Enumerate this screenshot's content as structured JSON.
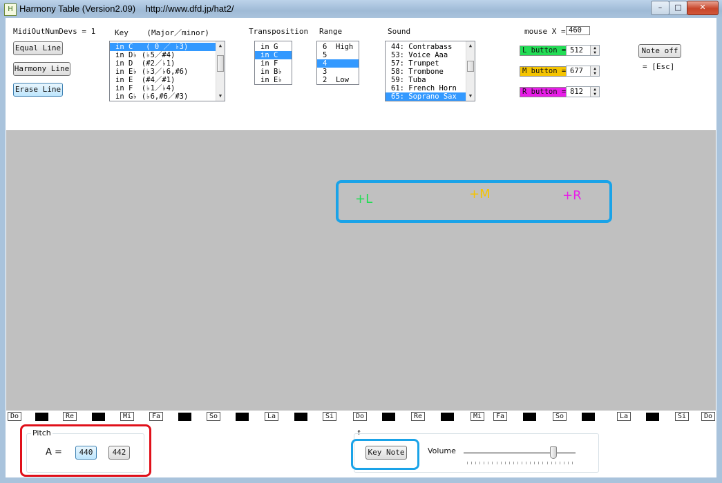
{
  "window": {
    "title": "Harmony Table (Version2.09)    http://www.dfd.jp/hat2/",
    "icon_text": "H",
    "minimize": "–",
    "maximize": "□",
    "close": "✕"
  },
  "midi": {
    "label": "MidiOutNumDevs = 1"
  },
  "line_buttons": {
    "equal": "Equal Line",
    "harmony": "Harmony Line",
    "erase": "Erase Line"
  },
  "key": {
    "header": "Key    (Major／minor)",
    "items": [
      "in C   ( 0 ／ ♭3)",
      "in D♭ (♭5／#4)",
      "in D  (#2／♭1)",
      "in E♭ (♭3／♭6,#6)",
      "in E  (#4／#1)",
      "in F  (♭1／♭4)",
      "in G♭ (♭6,#6／#3)"
    ],
    "selected_index": 0
  },
  "transposition": {
    "header": "Transposition",
    "items": [
      "in G",
      "in C",
      "in F",
      "in B♭",
      "in E♭"
    ],
    "selected_index": 1
  },
  "range": {
    "header": "Range",
    "items": [
      "6  High",
      "5",
      "4",
      "3",
      "2  Low"
    ],
    "selected_index": 2
  },
  "sound": {
    "header": "Sound",
    "items": [
      "44: Contrabass",
      "53: Voice Aaa",
      "57: Trumpet",
      "58: Trombone",
      "59: Tuba",
      "61: French Horn",
      "65: Soprano Sax"
    ],
    "selected_index": 6
  },
  "mouse": {
    "label": "mouse X =",
    "value": "460"
  },
  "mouse_buttons": {
    "l_label": "L button =",
    "l_value": "512",
    "l_color": "#22dd55",
    "m_label": "M button =",
    "m_value": "677",
    "m_color": "#f5c400",
    "r_label": "R button =",
    "r_value": "812",
    "r_color": "#e81ee8"
  },
  "note_off": {
    "label": "Note off",
    "shortcut": "= [Esc]"
  },
  "canvas": {
    "bg_color": "#c0c0c0",
    "marker_l": "+L",
    "marker_m": "+M",
    "marker_r": "+R",
    "highlight_color": "#1aa3e8"
  },
  "keyboard": {
    "white_labels": [
      "Do",
      "Re",
      "Mi",
      "Fa",
      "So",
      "La",
      "Si",
      "Do",
      "Re",
      "Mi",
      "Fa",
      "So",
      "La",
      "Si",
      "Do"
    ],
    "cursor_arrow": "↑"
  },
  "pitch": {
    "group_label": "Pitch",
    "a_label": "A =",
    "option_440": "440",
    "option_442": "442",
    "selected": "440"
  },
  "bottom": {
    "key_note": "Key Note",
    "volume_label": "Volume",
    "volume_level": 0.82
  }
}
